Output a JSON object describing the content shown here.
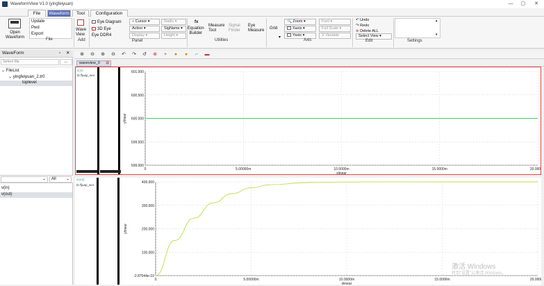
{
  "window": {
    "title": "WaveformView V1.0 (yingfeiyuan)",
    "controls": [
      "—",
      "▢",
      "✕"
    ]
  },
  "menu": {
    "tabs": [
      "File",
      "Waveform",
      "Tool",
      "Configuration"
    ]
  },
  "ribbon": {
    "open_waveform": "Open\nWaveform",
    "file_actions": [
      "Update",
      "Pwd",
      "Export"
    ],
    "file_label": "File",
    "wave_view": "Wave\nView",
    "add_label": "Add",
    "eye_items": [
      "Eye Diagram",
      "3D Eye",
      "Eye DDR4"
    ],
    "cursor": "Cursor",
    "action": "Action",
    "display": "Display",
    "radix": "Radix",
    "signame": "SigName",
    "height": "Height",
    "panel_label": "Panel",
    "equation_builder": "Equation\nBuilder",
    "measure_tool": "Measure\nTool",
    "signal_finder": "Signal\nFinder",
    "eye_measure": "Eye\nMeasure",
    "utilities_label": "Utilities",
    "grid": "Grid",
    "zoom": "Zoom",
    "xaxis": "Xaxis",
    "yaxis": "Yaxis",
    "font": "Font",
    "full_scale": "Full Scale",
    "x_variable": "X Variable",
    "axis_label": "Axis",
    "undo": "Undo",
    "redo": "Redo",
    "delete_all": "Delete ALL",
    "select_view": "Select View",
    "edit_label": "Edit",
    "settings_label": "Settings"
  },
  "left_panel": {
    "title": "WaveForm",
    "select_file_placeholder": "Select file",
    "browse": "...",
    "tree": {
      "root": "FileList",
      "file": "yingfeiyuan_2.tr0",
      "node": "toplevel"
    },
    "filter_value": "",
    "filter_all": "All",
    "signals": [
      "v(in)",
      "v(out)"
    ]
  },
  "tabs": {
    "active": "waveview_0"
  },
  "plots": [
    {
      "path_label": "D:/fjuap_wor",
      "name_label": "v(in)",
      "ylabel": "ylinear",
      "xlabel": "xlinear",
      "yticks": [
        "601.000",
        "600.500",
        "600.000",
        "599.500",
        "599.000"
      ],
      "xticks": [
        "0",
        "5.00000m",
        "10.0000m",
        "15.0000m",
        "20.0000m"
      ]
    },
    {
      "path_label": "D:/fjuap_wor",
      "name_label": "v(out)",
      "ylabel": "ylinear",
      "xlabel": "xlinear",
      "yticks": [
        "400.000",
        "300.000",
        "200.000",
        "100.000",
        "-2.87044e-10"
      ],
      "xticks": [
        "0",
        "5.00000m",
        "10.0000m",
        "15.0000m",
        "20.0000m"
      ]
    }
  ],
  "chart_data": [
    {
      "type": "line",
      "xlabel": "xlinear",
      "ylabel": "ylinear",
      "xlim": [
        0,
        0.02
      ],
      "ylim": [
        599,
        601
      ],
      "grid": true,
      "series": [
        {
          "name": "v(in)",
          "color": "#44cc66",
          "x": [
            0,
            0.02
          ],
          "values": [
            600,
            600
          ]
        }
      ]
    },
    {
      "type": "line",
      "xlabel": "xlinear",
      "ylabel": "ylinear",
      "xlim": [
        0,
        0.02
      ],
      "ylim": [
        -2.87044e-10,
        400
      ],
      "grid": true,
      "series": [
        {
          "name": "v(out)",
          "color": "#b8e04a",
          "x": [
            0,
            0.001,
            0.002,
            0.003,
            0.004,
            0.005,
            0.006,
            0.008,
            0.01,
            0.015,
            0.02
          ],
          "values": [
            0,
            150,
            245,
            310,
            350,
            375,
            388,
            397,
            399.5,
            400,
            400
          ]
        }
      ]
    }
  ],
  "watermark": {
    "line1": "激活 Windows",
    "line2": "转到\"设置\"以激活 Windows。"
  },
  "colors": {
    "accent": "#5a6fb6",
    "active_border": "#ee4444",
    "trace1": "#44cc66",
    "trace2": "#b8e04a"
  }
}
